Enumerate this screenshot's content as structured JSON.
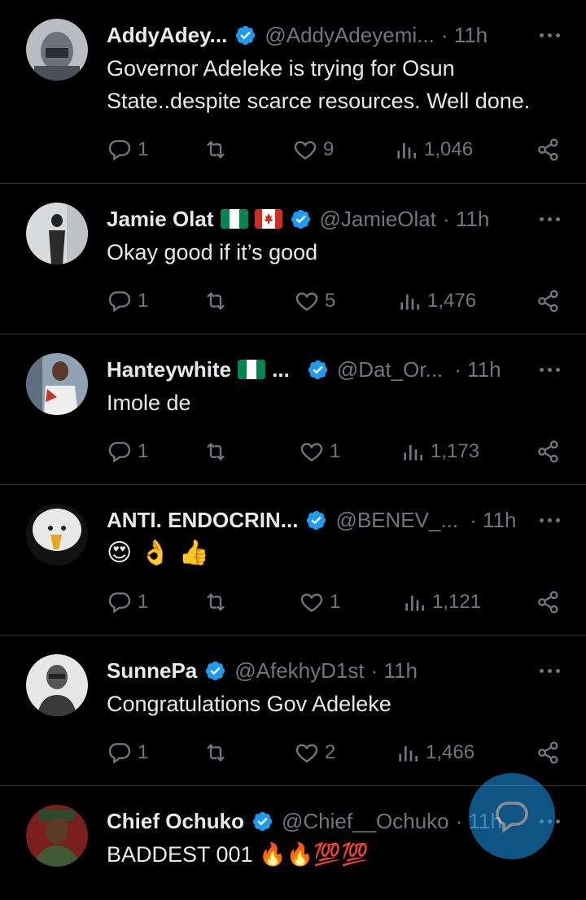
{
  "tweets": [
    {
      "name": "AddyAdey...",
      "handle": "@AddyAdeyemi...",
      "time": "· 11h",
      "text": "Governor Adeleke is trying for Osun State..despite scarce resources. Well done.",
      "replies": "1",
      "retweets": "",
      "likes": "9",
      "views": "1,046"
    },
    {
      "name": "Jamie Olat",
      "handle": "@JamieOlat",
      "time": "· 11h",
      "text": "Okay good if it’s good",
      "replies": "1",
      "retweets": "",
      "likes": "5",
      "views": "1,476"
    },
    {
      "name": "Hanteywhite",
      "name_suffix": "...",
      "handle": "@Dat_Or...",
      "time": "· 11h",
      "text": "Imole de",
      "replies": "1",
      "retweets": "",
      "likes": "1",
      "views": "1,173"
    },
    {
      "name": "ANTI. ENDOCRIN...",
      "handle": "@BENEV_...",
      "time": "· 11h",
      "text": "😍👌👍",
      "replies": "1",
      "retweets": "",
      "likes": "1",
      "views": "1,121"
    },
    {
      "name": "SunnePa",
      "handle": "@AfekhyD1st",
      "time": "· 11h",
      "text": "Congratulations Gov Adeleke",
      "replies": "1",
      "retweets": "",
      "likes": "2",
      "views": "1,466"
    },
    {
      "name": "Chief Ochuko",
      "handle": "@Chief__Ochuko",
      "time": "· 11h",
      "text": "BADDEST 001 🔥🔥💯💯"
    }
  ],
  "colors": {
    "background": "#000000",
    "text": "#e7e9ea",
    "secondary": "#71767b",
    "verified": "#1d9bf0",
    "divider": "#2f3336"
  },
  "icons": [
    "reply-icon",
    "retweet-icon",
    "like-icon",
    "views-icon",
    "share-icon",
    "verified-badge-icon",
    "more-icon",
    "compose-reply-icon"
  ]
}
